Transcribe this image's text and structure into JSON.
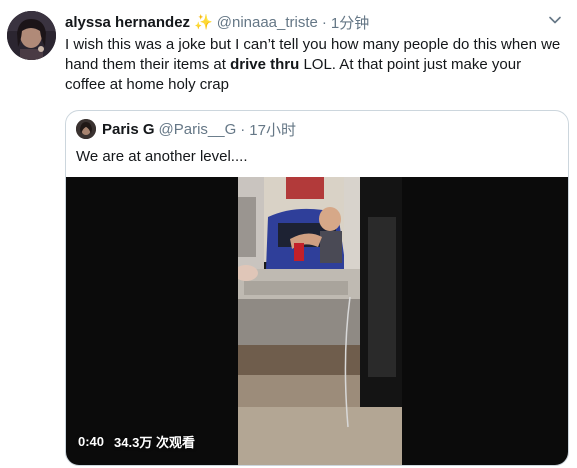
{
  "tweet": {
    "display_name": "alyssa hernandez",
    "display_emoji": "✨",
    "handle": "@ninaaa_triste",
    "separator": "·",
    "time": "1分钟",
    "text_part1": "I wish this was a joke but I can’t tell you how many people do this when we hand them their items at ",
    "text_bold": "drive thru",
    "text_part2": " LOL. At that point just make your coffee at home holy crap"
  },
  "quoted": {
    "display_name": "Paris G",
    "handle": "@Paris__G",
    "separator": "·",
    "time": "17小时",
    "text": "We are at another level....",
    "video": {
      "duration": "0:40",
      "views": "34.3万 次观看"
    }
  },
  "colors": {
    "text": "#14171a",
    "muted": "#657786",
    "border": "#ccd6dd",
    "sparkle": "#f4b400"
  },
  "icons": [
    "caret-down-icon",
    "sparkle-icon"
  ]
}
